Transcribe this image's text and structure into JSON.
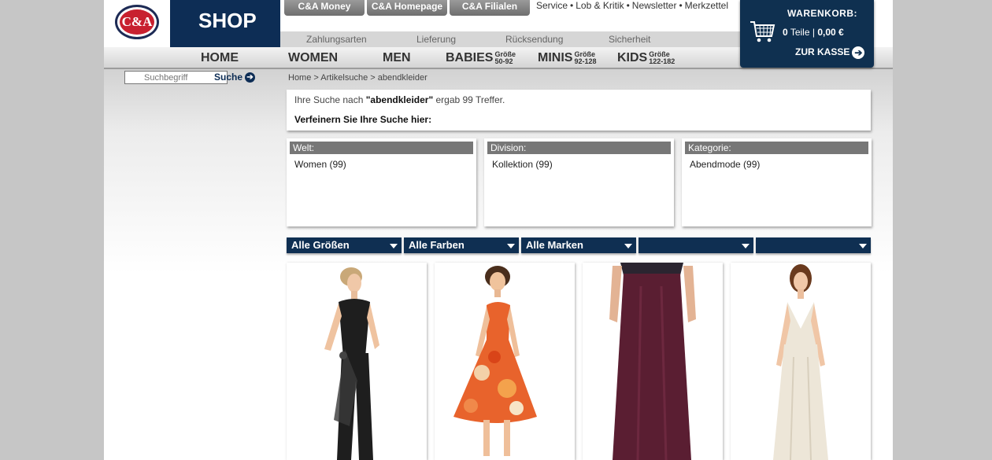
{
  "brand": {
    "logo_text": "C&A",
    "shop_label": "SHOP"
  },
  "top_tabs": [
    "C&A Money",
    "C&A Homepage",
    "C&A Filialen"
  ],
  "top_links": [
    "Service",
    "Lob & Kritik",
    "Newsletter",
    "Merkzettel"
  ],
  "sub_nav": [
    "Zahlungsarten",
    "Lieferung",
    "Rücksendung",
    "Sicherheit"
  ],
  "main_nav": [
    {
      "label": "HOME",
      "size": ""
    },
    {
      "label": "WOMEN",
      "size": ""
    },
    {
      "label": "MEN",
      "size": ""
    },
    {
      "label": "BABIES",
      "size_top": "Größe",
      "size_bottom": "50-92"
    },
    {
      "label": "MINIS",
      "size_top": "Größe",
      "size_bottom": "92-128"
    },
    {
      "label": "KIDS",
      "size_top": "Größe",
      "size_bottom": "122-182"
    }
  ],
  "cart": {
    "title": "WARENKORB:",
    "count": "0",
    "count_label": "Teile",
    "separator": "|",
    "total": "0,00 €",
    "checkout": "ZUR KASSE",
    "icon": "shopping-cart-icon"
  },
  "search": {
    "placeholder": "Suchbegriff",
    "button": "Suche"
  },
  "breadcrumb": {
    "items": [
      "Home",
      "Artikelsuche",
      "abendkleider"
    ],
    "separator": ">"
  },
  "result": {
    "prefix": "Ihre Suche nach ",
    "query": "\"abendkleider\"",
    "suffix": " ergab 99 Treffer.",
    "refine": "Verfeinern Sie Ihre Suche hier:"
  },
  "facets": [
    {
      "header": "Welt:",
      "item": "Women (99)"
    },
    {
      "header": "Division:",
      "item": "Kollektion (99)"
    },
    {
      "header": "Kategorie:",
      "item": "Abendmode (99)"
    }
  ],
  "filters": [
    "Alle Größen",
    "Alle Farben",
    "Alle Marken",
    "",
    ""
  ],
  "products": [
    {
      "name": "black-dress-product",
      "dress_color": "#1e1e1e"
    },
    {
      "name": "orange-floral-dress-product",
      "dress_color": "#e8632c"
    },
    {
      "name": "plum-long-skirt-product",
      "dress_color": "#5a1e32"
    },
    {
      "name": "cream-gown-product",
      "dress_color": "#ede6d8"
    }
  ],
  "colors": {
    "navy": "#0d2d55",
    "logo_red": "#c8202f",
    "facet_header": "#777777"
  }
}
